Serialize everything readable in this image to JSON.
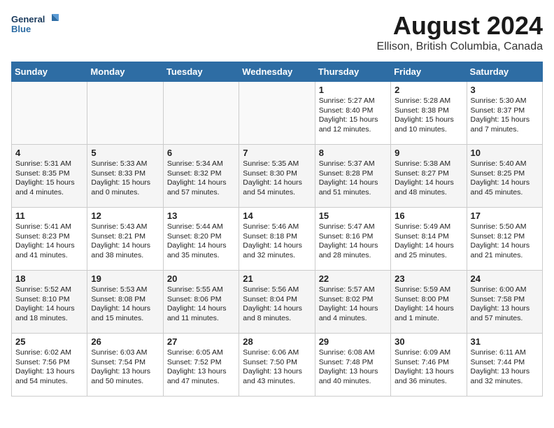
{
  "logo": {
    "line1": "General",
    "line2": "Blue"
  },
  "title": "August 2024",
  "subtitle": "Ellison, British Columbia, Canada",
  "days_of_week": [
    "Sunday",
    "Monday",
    "Tuesday",
    "Wednesday",
    "Thursday",
    "Friday",
    "Saturday"
  ],
  "weeks": [
    [
      {
        "day": "",
        "info": ""
      },
      {
        "day": "",
        "info": ""
      },
      {
        "day": "",
        "info": ""
      },
      {
        "day": "",
        "info": ""
      },
      {
        "day": "1",
        "info": "Sunrise: 5:27 AM\nSunset: 8:40 PM\nDaylight: 15 hours\nand 12 minutes."
      },
      {
        "day": "2",
        "info": "Sunrise: 5:28 AM\nSunset: 8:38 PM\nDaylight: 15 hours\nand 10 minutes."
      },
      {
        "day": "3",
        "info": "Sunrise: 5:30 AM\nSunset: 8:37 PM\nDaylight: 15 hours\nand 7 minutes."
      }
    ],
    [
      {
        "day": "4",
        "info": "Sunrise: 5:31 AM\nSunset: 8:35 PM\nDaylight: 15 hours\nand 4 minutes."
      },
      {
        "day": "5",
        "info": "Sunrise: 5:33 AM\nSunset: 8:33 PM\nDaylight: 15 hours\nand 0 minutes."
      },
      {
        "day": "6",
        "info": "Sunrise: 5:34 AM\nSunset: 8:32 PM\nDaylight: 14 hours\nand 57 minutes."
      },
      {
        "day": "7",
        "info": "Sunrise: 5:35 AM\nSunset: 8:30 PM\nDaylight: 14 hours\nand 54 minutes."
      },
      {
        "day": "8",
        "info": "Sunrise: 5:37 AM\nSunset: 8:28 PM\nDaylight: 14 hours\nand 51 minutes."
      },
      {
        "day": "9",
        "info": "Sunrise: 5:38 AM\nSunset: 8:27 PM\nDaylight: 14 hours\nand 48 minutes."
      },
      {
        "day": "10",
        "info": "Sunrise: 5:40 AM\nSunset: 8:25 PM\nDaylight: 14 hours\nand 45 minutes."
      }
    ],
    [
      {
        "day": "11",
        "info": "Sunrise: 5:41 AM\nSunset: 8:23 PM\nDaylight: 14 hours\nand 41 minutes."
      },
      {
        "day": "12",
        "info": "Sunrise: 5:43 AM\nSunset: 8:21 PM\nDaylight: 14 hours\nand 38 minutes."
      },
      {
        "day": "13",
        "info": "Sunrise: 5:44 AM\nSunset: 8:20 PM\nDaylight: 14 hours\nand 35 minutes."
      },
      {
        "day": "14",
        "info": "Sunrise: 5:46 AM\nSunset: 8:18 PM\nDaylight: 14 hours\nand 32 minutes."
      },
      {
        "day": "15",
        "info": "Sunrise: 5:47 AM\nSunset: 8:16 PM\nDaylight: 14 hours\nand 28 minutes."
      },
      {
        "day": "16",
        "info": "Sunrise: 5:49 AM\nSunset: 8:14 PM\nDaylight: 14 hours\nand 25 minutes."
      },
      {
        "day": "17",
        "info": "Sunrise: 5:50 AM\nSunset: 8:12 PM\nDaylight: 14 hours\nand 21 minutes."
      }
    ],
    [
      {
        "day": "18",
        "info": "Sunrise: 5:52 AM\nSunset: 8:10 PM\nDaylight: 14 hours\nand 18 minutes."
      },
      {
        "day": "19",
        "info": "Sunrise: 5:53 AM\nSunset: 8:08 PM\nDaylight: 14 hours\nand 15 minutes."
      },
      {
        "day": "20",
        "info": "Sunrise: 5:55 AM\nSunset: 8:06 PM\nDaylight: 14 hours\nand 11 minutes."
      },
      {
        "day": "21",
        "info": "Sunrise: 5:56 AM\nSunset: 8:04 PM\nDaylight: 14 hours\nand 8 minutes."
      },
      {
        "day": "22",
        "info": "Sunrise: 5:57 AM\nSunset: 8:02 PM\nDaylight: 14 hours\nand 4 minutes."
      },
      {
        "day": "23",
        "info": "Sunrise: 5:59 AM\nSunset: 8:00 PM\nDaylight: 14 hours\nand 1 minute."
      },
      {
        "day": "24",
        "info": "Sunrise: 6:00 AM\nSunset: 7:58 PM\nDaylight: 13 hours\nand 57 minutes."
      }
    ],
    [
      {
        "day": "25",
        "info": "Sunrise: 6:02 AM\nSunset: 7:56 PM\nDaylight: 13 hours\nand 54 minutes."
      },
      {
        "day": "26",
        "info": "Sunrise: 6:03 AM\nSunset: 7:54 PM\nDaylight: 13 hours\nand 50 minutes."
      },
      {
        "day": "27",
        "info": "Sunrise: 6:05 AM\nSunset: 7:52 PM\nDaylight: 13 hours\nand 47 minutes."
      },
      {
        "day": "28",
        "info": "Sunrise: 6:06 AM\nSunset: 7:50 PM\nDaylight: 13 hours\nand 43 minutes."
      },
      {
        "day": "29",
        "info": "Sunrise: 6:08 AM\nSunset: 7:48 PM\nDaylight: 13 hours\nand 40 minutes."
      },
      {
        "day": "30",
        "info": "Sunrise: 6:09 AM\nSunset: 7:46 PM\nDaylight: 13 hours\nand 36 minutes."
      },
      {
        "day": "31",
        "info": "Sunrise: 6:11 AM\nSunset: 7:44 PM\nDaylight: 13 hours\nand 32 minutes."
      }
    ]
  ]
}
